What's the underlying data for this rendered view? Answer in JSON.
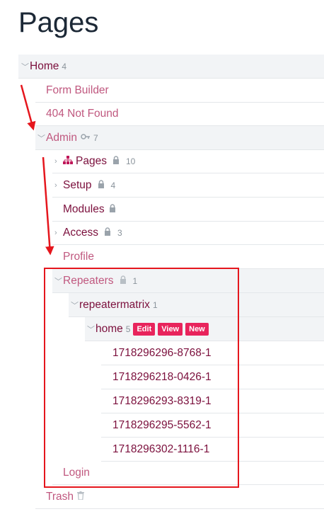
{
  "page": {
    "title": "Pages"
  },
  "tree": {
    "home": {
      "label": "Home",
      "count": "4"
    },
    "form_builder": {
      "label": "Form Builder"
    },
    "not_found": {
      "label": "404 Not Found"
    },
    "admin": {
      "label": "Admin",
      "count": "7",
      "icon": "key-icon"
    },
    "pages": {
      "label": "Pages",
      "count": "10",
      "icon": "sitemap-icon"
    },
    "setup": {
      "label": "Setup",
      "count": "4"
    },
    "modules": {
      "label": "Modules"
    },
    "access": {
      "label": "Access",
      "count": "3"
    },
    "profile": {
      "label": "Profile"
    },
    "repeaters": {
      "label": "Repeaters",
      "count": "1"
    },
    "repeatermatrix": {
      "label": "repeatermatrix",
      "count": "1"
    },
    "home2": {
      "label": "home",
      "count": "5",
      "actions": [
        "Edit",
        "View",
        "New"
      ]
    },
    "items": [
      "1718296296-8768-1",
      "1718296218-0426-1",
      "1718296293-8319-1",
      "1718296295-5562-1",
      "1718296302-1116-1"
    ],
    "login": {
      "label": "Login"
    },
    "trash": {
      "label": "Trash",
      "icon": "trash-icon"
    }
  },
  "colors": {
    "label": "#7b0f3c",
    "muted": "#c0587f",
    "button": "#e8245c",
    "highlight": "#e5161d"
  }
}
